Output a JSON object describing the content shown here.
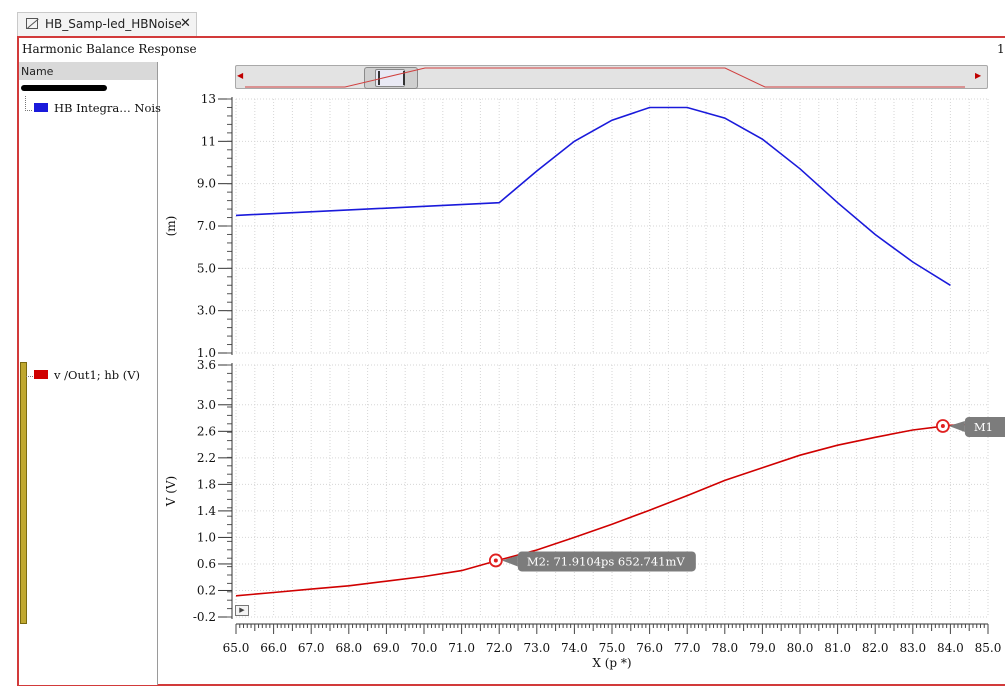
{
  "tab": {
    "title": "HB_Samp-led_HBNoise",
    "close": "✕"
  },
  "panel_title": "Harmonic Balance Response",
  "corner_label": "1",
  "sidebar": {
    "header": "Name"
  },
  "legend": [
    {
      "label": "HB Integra… Nois",
      "color": "#1a1adb"
    },
    {
      "label": "v /Out1; hb (V)",
      "color": "#d00000"
    }
  ],
  "x_axis": {
    "label": "X (p *)",
    "ticks": [
      "65.0",
      "66.0",
      "67.0",
      "68.0",
      "69.0",
      "70.0",
      "71.0",
      "72.0",
      "73.0",
      "74.0",
      "75.0",
      "76.0",
      "77.0",
      "78.0",
      "79.0",
      "80.0",
      "81.0",
      "82.0",
      "83.0",
      "84.0",
      "85.0"
    ]
  },
  "chart_data": [
    {
      "type": "line",
      "ylabel": "(m)",
      "ylim": [
        1.0,
        13.0
      ],
      "yticks": [
        "13",
        "11",
        "9.0",
        "7.0",
        "5.0",
        "3.0",
        "1.0"
      ],
      "xlim": [
        65.0,
        85.0
      ],
      "grid": true,
      "series": [
        {
          "name": "HB Integra… Nois",
          "color": "#1a1adb",
          "x": [
            65.0,
            72.0,
            73.0,
            74.0,
            75.0,
            76.0,
            77.0,
            78.0,
            79.0,
            80.0,
            81.0,
            82.0,
            83.0,
            84.0
          ],
          "y": [
            7.5,
            8.1,
            9.6,
            11.0,
            12.0,
            12.6,
            12.6,
            12.1,
            11.1,
            9.7,
            8.1,
            6.6,
            5.3,
            4.2
          ]
        }
      ]
    },
    {
      "type": "line",
      "ylabel": "V (V)",
      "ylim": [
        -0.2,
        3.6
      ],
      "yticks": [
        "3.6",
        "3.0",
        "2.6",
        "2.2",
        "1.8",
        "1.4",
        "1.0",
        "0.6",
        "0.2",
        "-0.2"
      ],
      "xlim": [
        65.0,
        85.0
      ],
      "grid": true,
      "series": [
        {
          "name": "v /Out1; hb (V)",
          "color": "#d00000",
          "x": [
            65.0,
            66.0,
            67.0,
            68.0,
            69.0,
            70.0,
            71.0,
            72.0,
            73.0,
            74.0,
            75.0,
            76.0,
            77.0,
            78.0,
            79.0,
            80.0,
            81.0,
            82.0,
            83.0,
            84.0,
            85.0
          ],
          "y": [
            0.12,
            0.17,
            0.22,
            0.27,
            0.34,
            0.41,
            0.5,
            0.66,
            0.81,
            1.0,
            1.2,
            1.41,
            1.63,
            1.86,
            2.05,
            2.24,
            2.39,
            2.51,
            2.62,
            2.69,
            2.72
          ]
        }
      ],
      "markers": [
        {
          "x": 71.9104,
          "y": 0.652741,
          "label": "M2: 71.9104ps 652.741mV"
        },
        {
          "x": 83.8,
          "y": 2.68,
          "label": "M1"
        }
      ]
    }
  ]
}
